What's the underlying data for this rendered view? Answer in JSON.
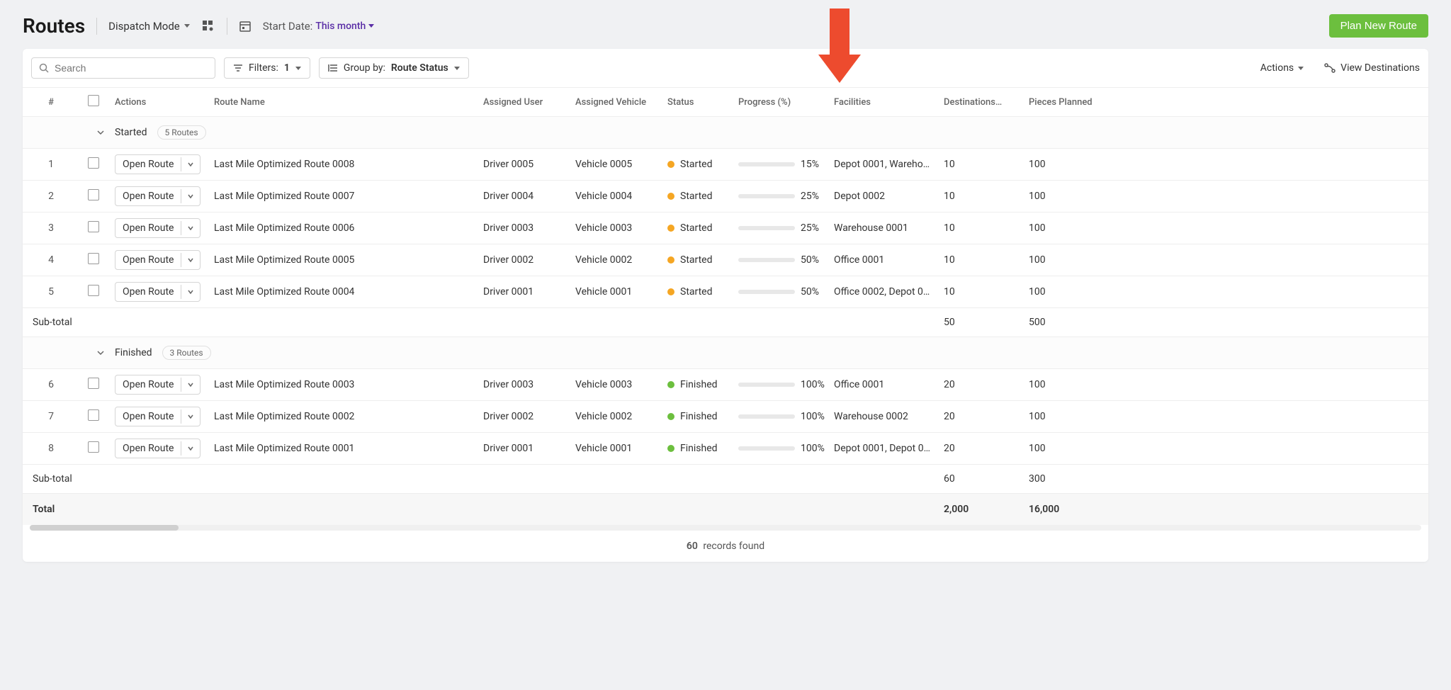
{
  "header": {
    "title": "Routes",
    "mode_label": "Dispatch Mode",
    "start_date_label": "Start Date:",
    "start_date_value": "This month",
    "plan_button": "Plan New Route"
  },
  "toolbar": {
    "search_placeholder": "Search",
    "filters_label": "Filters:",
    "filters_count": "1",
    "groupby_label": "Group by:",
    "groupby_value": "Route Status",
    "actions_label": "Actions",
    "view_destinations": "View Destinations"
  },
  "columns": {
    "num": "#",
    "actions": "Actions",
    "route_name": "Route Name",
    "assigned_user": "Assigned User",
    "assigned_vehicle": "Assigned Vehicle",
    "status": "Status",
    "progress": "Progress (%)",
    "facilities": "Facilities",
    "destinations": "Destinations…",
    "pieces": "Pieces Planned"
  },
  "open_route_label": "Open Route",
  "groups": [
    {
      "name": "Started",
      "count_label": "5 Routes",
      "rows": [
        {
          "n": "1",
          "name": "Last Mile Optimized Route 0008",
          "user": "Driver 0005",
          "vehicle": "Vehicle 0005",
          "status": "Started",
          "dot": "orange",
          "progress": 15,
          "progress_label": "15%",
          "facilities": "Depot 0001, Wareho…",
          "dest": "10",
          "pieces": "100"
        },
        {
          "n": "2",
          "name": "Last Mile Optimized Route 0007",
          "user": "Driver 0004",
          "vehicle": "Vehicle 0004",
          "status": "Started",
          "dot": "orange",
          "progress": 25,
          "progress_label": "25%",
          "facilities": "Depot 0002",
          "dest": "10",
          "pieces": "100"
        },
        {
          "n": "3",
          "name": "Last Mile Optimized Route 0006",
          "user": "Driver 0003",
          "vehicle": "Vehicle 0003",
          "status": "Started",
          "dot": "orange",
          "progress": 25,
          "progress_label": "25%",
          "facilities": "Warehouse 0001",
          "dest": "10",
          "pieces": "100"
        },
        {
          "n": "4",
          "name": "Last Mile Optimized Route 0005",
          "user": "Driver 0002",
          "vehicle": "Vehicle 0002",
          "status": "Started",
          "dot": "orange",
          "progress": 50,
          "progress_label": "50%",
          "facilities": "Office 0001",
          "dest": "10",
          "pieces": "100"
        },
        {
          "n": "5",
          "name": "Last Mile Optimized Route 0004",
          "user": "Driver 0001",
          "vehicle": "Vehicle 0001",
          "status": "Started",
          "dot": "orange",
          "progress": 50,
          "progress_label": "50%",
          "facilities": "Office 0002, Depot 0…",
          "dest": "10",
          "pieces": "100"
        }
      ],
      "subtotal": {
        "label": "Sub-total",
        "dest": "50",
        "pieces": "500"
      }
    },
    {
      "name": "Finished",
      "count_label": "3 Routes",
      "rows": [
        {
          "n": "6",
          "name": "Last Mile Optimized Route 0003",
          "user": "Driver 0003",
          "vehicle": "Vehicle 0003",
          "status": "Finished",
          "dot": "green",
          "progress": 100,
          "progress_label": "100%",
          "facilities": "Office 0001",
          "dest": "20",
          "pieces": "100"
        },
        {
          "n": "7",
          "name": "Last Mile Optimized Route 0002",
          "user": "Driver 0002",
          "vehicle": "Vehicle 0002",
          "status": "Finished",
          "dot": "green",
          "progress": 100,
          "progress_label": "100%",
          "facilities": "Warehouse 0002",
          "dest": "20",
          "pieces": "100"
        },
        {
          "n": "8",
          "name": "Last Mile Optimized Route 0001",
          "user": "Driver 0001",
          "vehicle": "Vehicle 0001",
          "status": "Finished",
          "dot": "green",
          "progress": 100,
          "progress_label": "100%",
          "facilities": "Depot 0001, Depot 0…",
          "dest": "20",
          "pieces": "100"
        }
      ],
      "subtotal": {
        "label": "Sub-total",
        "dest": "60",
        "pieces": "300"
      }
    }
  ],
  "total": {
    "label": "Total",
    "dest": "2,000",
    "pieces": "16,000"
  },
  "footer": {
    "count": "60",
    "label": "records found"
  }
}
